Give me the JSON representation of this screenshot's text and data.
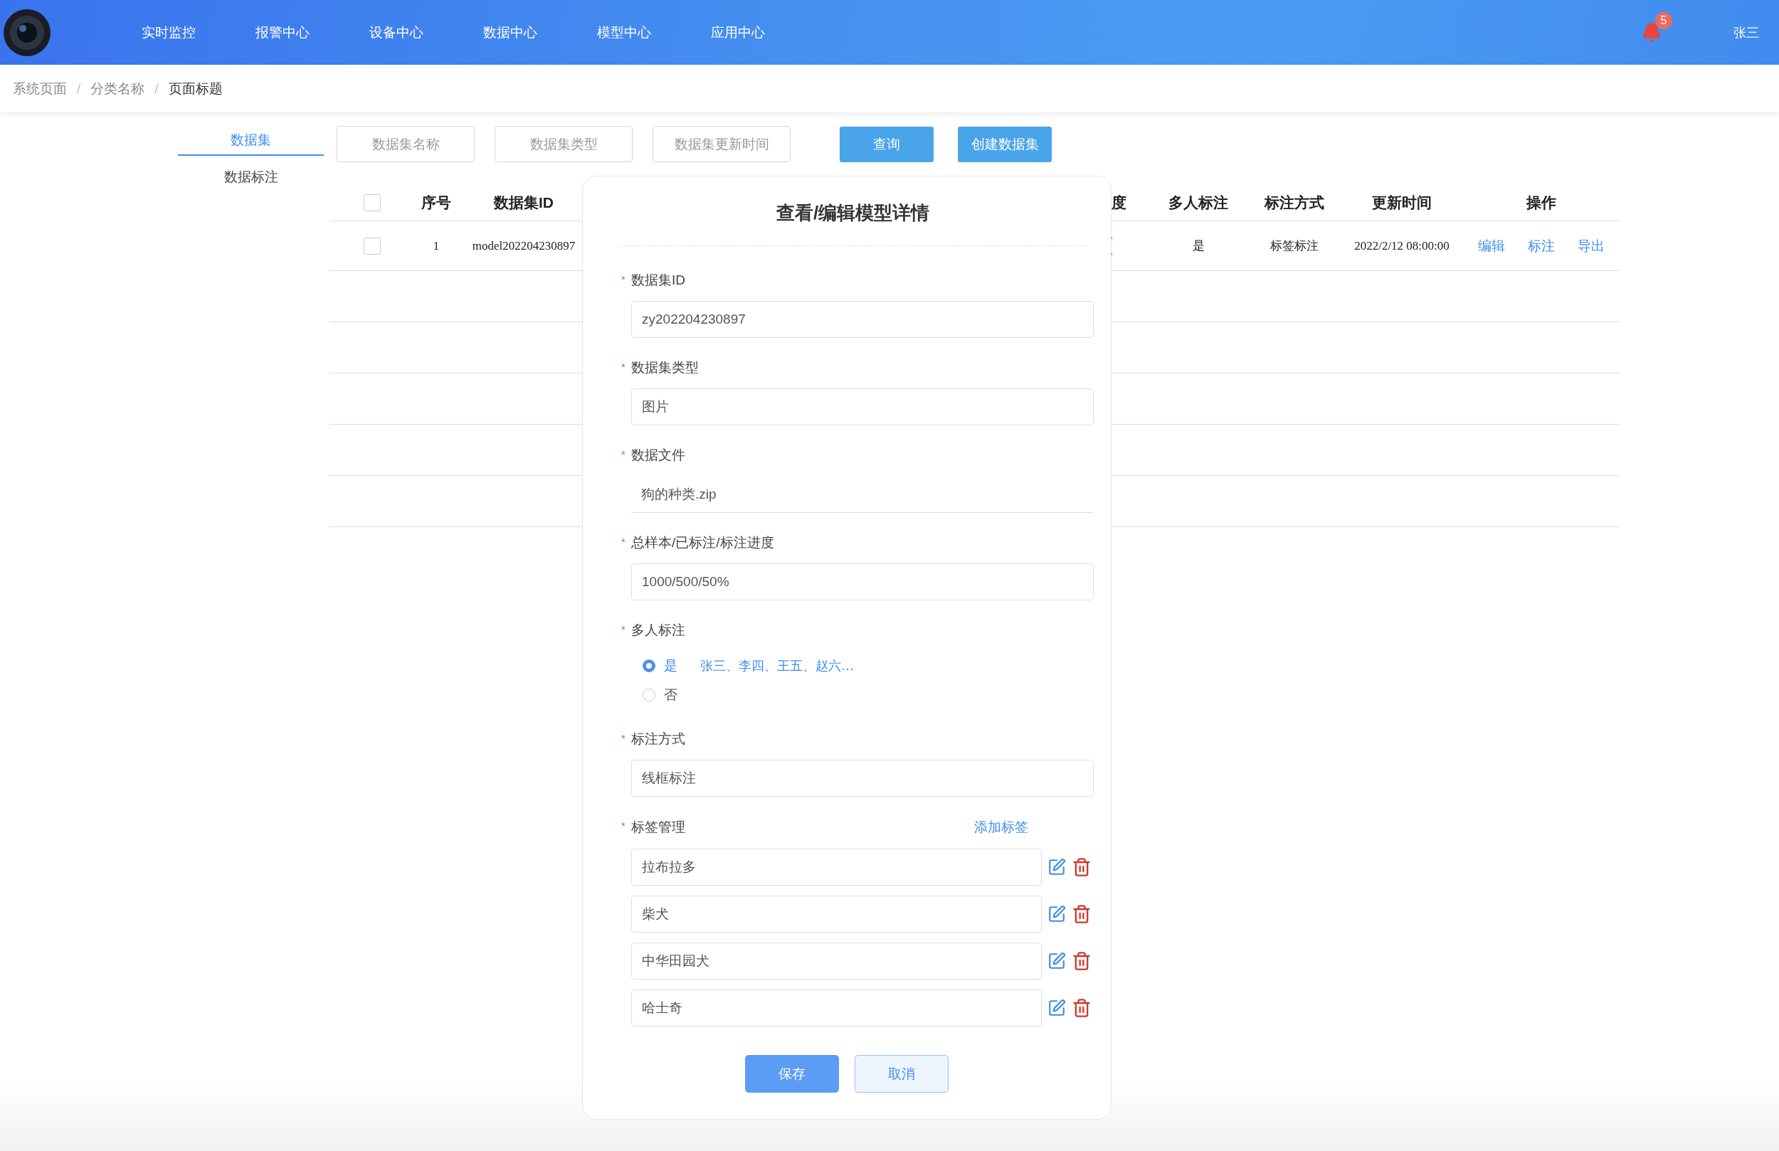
{
  "header": {
    "nav": [
      {
        "label": "实时监控"
      },
      {
        "label": "报警中心"
      },
      {
        "label": "设备中心"
      },
      {
        "label": "数据中心"
      },
      {
        "label": "模型中心"
      },
      {
        "label": "应用中心"
      }
    ],
    "notification_count": "5",
    "user": "张三"
  },
  "breadcrumb": [
    {
      "label": "系统页面"
    },
    {
      "separator": "/",
      "label": "分类名称"
    },
    {
      "separator": "/",
      "label": "页面标题"
    }
  ],
  "side_tabs": [
    {
      "label": "数据集",
      "selected": true
    },
    {
      "label": "数据标注",
      "selected": false
    }
  ],
  "filters": [
    {
      "placeholder": "数据集名称"
    },
    {
      "placeholder": "数据集类型"
    },
    {
      "placeholder": "数据集更新时间"
    }
  ],
  "toolbar_buttons": [
    {
      "label": "查询"
    },
    {
      "label": "创建数据集"
    }
  ],
  "table": {
    "columns": [
      {
        "kind": "checkbox",
        "checked": false
      },
      {
        "kind": "text",
        "label": "序号"
      },
      {
        "kind": "text",
        "label": "数据集ID"
      },
      {
        "kind": "covered",
        "label": "度"
      },
      {
        "kind": "text",
        "label": "多人标注"
      },
      {
        "kind": "text",
        "label": "标注方式"
      },
      {
        "kind": "text",
        "label": "更新时间"
      },
      {
        "kind": "text",
        "label": "操作"
      }
    ],
    "rows": [
      {
        "checked": false,
        "index": "1",
        "dataset_id": "model202204230897",
        "multi_annotator": "是",
        "method": "标签标注",
        "updated": "2022/2/12 08:00:00",
        "actions": [
          "编辑",
          "标注",
          "导出"
        ]
      }
    ]
  },
  "modal": {
    "title": "查看/编辑模型详情",
    "fields": [
      {
        "kind": "input",
        "required_mark": "*",
        "label": "数据集ID",
        "value": "zy202204230897"
      },
      {
        "kind": "input",
        "required_mark": "*",
        "label": "数据集类型",
        "value": "图片"
      },
      {
        "kind": "file",
        "required_mark": "*",
        "label": "数据文件",
        "value": "狗的种类.zip"
      },
      {
        "kind": "input",
        "required_mark": "*",
        "label": "总样本/已标注/标注进度",
        "value": "1000/500/50%"
      },
      {
        "kind": "radio",
        "required_mark": "*",
        "label": "多人标注",
        "options": [
          {
            "label": "是",
            "selected": true,
            "detail": "张三、李四、王五、赵六…"
          },
          {
            "label": "否",
            "selected": false
          }
        ]
      },
      {
        "kind": "input",
        "required_mark": "*",
        "label": "标注方式",
        "value": "线框标注"
      },
      {
        "kind": "tags",
        "required_mark": "*",
        "label": "标签管理",
        "action": "添加标签",
        "tags": [
          "拉布拉多",
          "柴犬",
          "中华田园犬",
          "哈士奇"
        ]
      }
    ],
    "buttons": [
      {
        "kind": "primary",
        "label": "保存"
      },
      {
        "kind": "secondary",
        "label": "取消"
      }
    ]
  }
}
